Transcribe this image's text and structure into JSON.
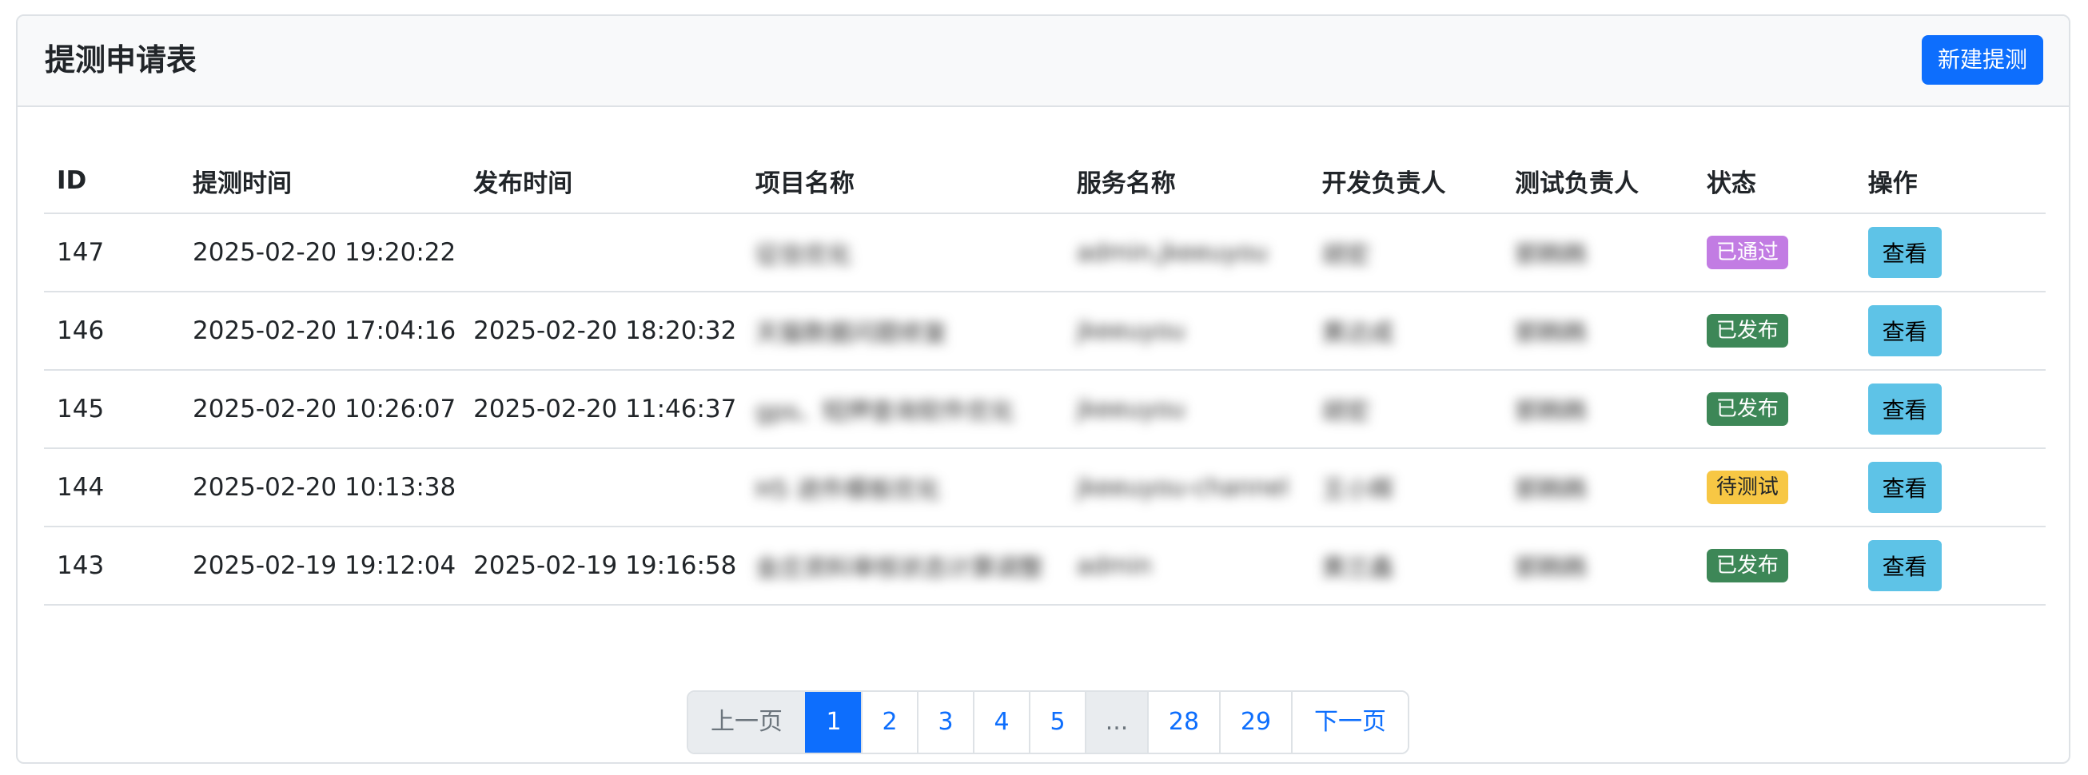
{
  "header": {
    "title": "提测申请表",
    "new_button": "新建提测"
  },
  "table": {
    "columns": [
      "ID",
      "提测时间",
      "发布时间",
      "项目名称",
      "服务名称",
      "开发负责人",
      "测试负责人",
      "状态",
      "操作"
    ],
    "rows": [
      {
        "id": "147",
        "submit_time": "2025-02-20 19:20:22",
        "release_time": "",
        "project": "征信优化",
        "service": "admin,jkeeuyou",
        "dev": "胡宏",
        "tester": "郭韩韩",
        "status": "已通过",
        "status_color": "#c27ce3",
        "action": "查看"
      },
      {
        "id": "146",
        "submit_time": "2025-02-20 17:04:16",
        "release_time": "2025-02-20 18:20:32",
        "project": "天猫数据问题修复",
        "service": "jkeeuyou",
        "dev": "黄达成",
        "tester": "郭韩韩",
        "status": "已发布",
        "status_color": "#3d8757",
        "action": "查看"
      },
      {
        "id": "145",
        "submit_time": "2025-02-20 10:26:07",
        "release_time": "2025-02-20 11:46:37",
        "project": "gps、短押查询软件优化",
        "service": "jkeeuyou",
        "dev": "胡宏",
        "tester": "郭韩韩",
        "status": "已发布",
        "status_color": "#3d8757",
        "action": "查看"
      },
      {
        "id": "144",
        "submit_time": "2025-02-20 10:13:38",
        "release_time": "",
        "project": "H5 进件模板优化",
        "service": "jkeeuyou-channel",
        "dev": "王小辉",
        "tester": "郭韩韩",
        "status": "待测试",
        "status_color": "#f7c744",
        "action": "查看"
      },
      {
        "id": "143",
        "submit_time": "2025-02-19 19:12:04",
        "release_time": "2025-02-19 19:16:58",
        "project": "金庄资料审核状态计算调整",
        "service": "admin",
        "dev": "黄兰鑫",
        "tester": "郭韩韩",
        "status": "已发布",
        "status_color": "#3d8757",
        "action": "查看"
      }
    ]
  },
  "pagination": {
    "prev": "上一页",
    "next": "下一页",
    "pages": [
      "1",
      "2",
      "3",
      "4",
      "5",
      "...",
      "28",
      "29"
    ],
    "current": "1"
  },
  "colors": {
    "primary": "#0d6efd",
    "info": "#5ec3e7",
    "border": "#dee2e6",
    "header_bg": "#f8f9fa"
  }
}
